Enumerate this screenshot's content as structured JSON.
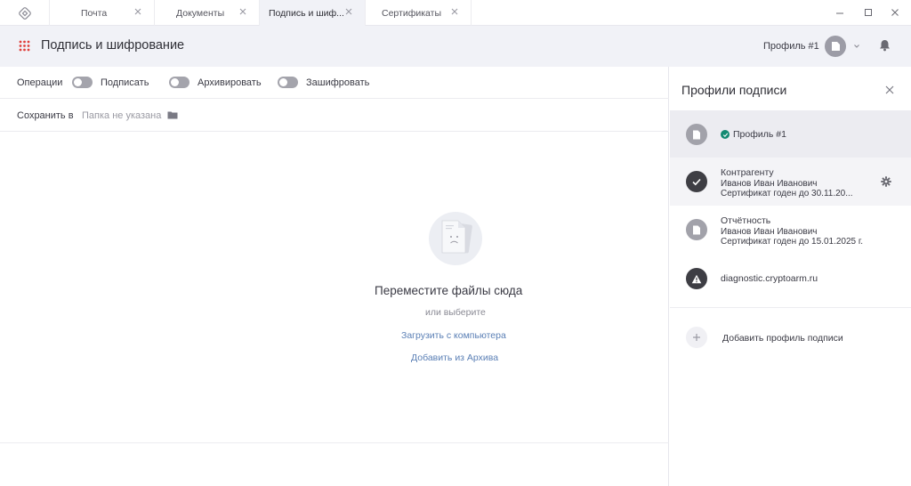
{
  "tabs": [
    {
      "label": "Почта"
    },
    {
      "label": "Документы"
    },
    {
      "label": "Подпись и шиф..."
    },
    {
      "label": "Сертификаты"
    }
  ],
  "header": {
    "title": "Подпись и шифрование",
    "profile_name": "Профиль #1"
  },
  "operations": {
    "label": "Операции",
    "toggles": [
      {
        "label": "Подписать",
        "on": false
      },
      {
        "label": "Архивировать",
        "on": false
      },
      {
        "label": "Зашифровать",
        "on": false
      }
    ]
  },
  "save": {
    "label": "Сохранить в",
    "folder": "Папка не указана"
  },
  "drop": {
    "title": "Переместите файлы сюда",
    "or": "или выберите",
    "upload_link": "Загрузить с компьютера",
    "archive_link": "Добавить из Архива"
  },
  "panel": {
    "title": "Профили подписи",
    "profiles": [
      {
        "name": "Профиль #1",
        "active": true
      },
      {
        "name": "Контрагенту",
        "owner": "Иванов Иван Иванович",
        "cert": "Сертификат годен до 30.11.20..."
      },
      {
        "name": "Отчётность",
        "owner": "Иванов Иван Иванович",
        "cert": "Сертификат годен до 15.01.2025 г."
      },
      {
        "name": "diagnostic.cryptoarm.ru"
      }
    ],
    "add_label": "Добавить профиль подписи"
  },
  "colors": {
    "accent_link": "#5a7fb5",
    "success": "#138a72",
    "apps_icon": "#e0413c"
  }
}
